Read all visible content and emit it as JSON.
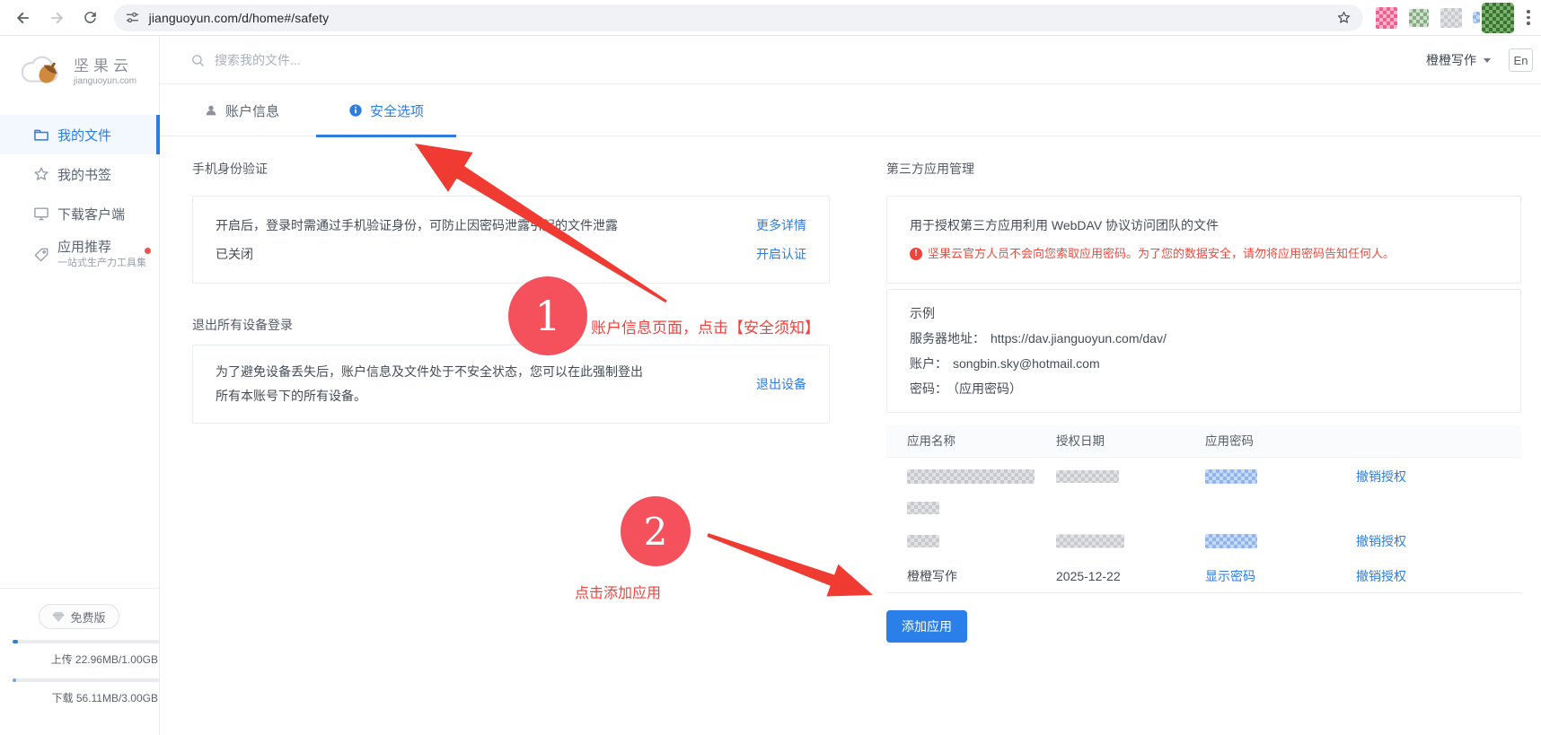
{
  "colors": {
    "accent": "#2d7ce0",
    "link": "#2d7de2",
    "annotation_red": "#f4515c",
    "arrow_red": "#ef3b31",
    "warning_red": "#f2493e",
    "button_blue": "#2b7fe9"
  },
  "browser": {
    "url": "jianguoyun.com/d/home#/safety",
    "blurred_extension_icons": [
      "pink",
      "green",
      "gray",
      "green"
    ]
  },
  "sidebar": {
    "logo": {
      "name": "坚果云",
      "domain": "jianguoyun.com"
    },
    "items": [
      {
        "label": "我的文件",
        "active": true
      },
      {
        "label": "我的书签"
      },
      {
        "label": "下载客户端"
      },
      {
        "label": "应用推荐",
        "subtitle": "一站式生产力工具集",
        "badge_dot": true
      }
    ],
    "plan": "免费版",
    "upload": {
      "label": "上传 22.96MB/1.00GB",
      "percent": 2.2
    },
    "download": {
      "label": "下载 56.11MB/3.00GB",
      "percent": 1.8
    }
  },
  "header": {
    "search_placeholder": "搜索我的文件...",
    "account": "橙橙写作",
    "lang": "En"
  },
  "tabs": [
    {
      "label": "账户信息"
    },
    {
      "label": "安全选项",
      "active": true
    }
  ],
  "phone_auth": {
    "title": "手机身份验证",
    "desc": "开启后，登录时需通过手机验证身份，可防止因密码泄露引起的文件泄露",
    "more": "更多详情",
    "status": "已关闭",
    "enable": "开启认证"
  },
  "logout_all": {
    "title": "退出所有设备登录",
    "desc": "为了避免设备丢失后，账户信息及文件处于不安全状态，您可以在此强制登出所有本账号下的所有设备。",
    "action": "退出设备"
  },
  "third_party": {
    "title": "第三方应用管理",
    "desc": "用于授权第三方应用利用 WebDAV 协议访问团队的文件",
    "warning": "坚果云官方人员不会向您索取应用密码。为了您的数据安全，请勿将应用密码告知任何人。",
    "example": {
      "title": "示例",
      "server_label": "服务器地址：",
      "server": "https://dav.jianguoyun.com/dav/",
      "account_label": "账户：",
      "account": "songbin.sky@hotmail.com",
      "password_label": "密码：",
      "password": "（应用密码）"
    },
    "table": {
      "headers": [
        "应用名称",
        "授权日期",
        "应用密码"
      ],
      "revoke": "撤销授权",
      "show_password": "显示密码",
      "rows": [
        {
          "name": "[blurred]",
          "name_wraps": true,
          "date": "[blurred]",
          "password": "[blurred]"
        },
        {
          "name": "[blurred]",
          "date": "[blurred]",
          "password": "[blurred]"
        },
        {
          "name": "橙橙写作",
          "date": "2025-12-22"
        }
      ]
    },
    "add_button": "添加应用"
  },
  "annotations": {
    "step1": {
      "num": "1",
      "text": "账户信息页面，点击【安全须知】"
    },
    "step2": {
      "num": "2",
      "text": "点击添加应用"
    }
  }
}
